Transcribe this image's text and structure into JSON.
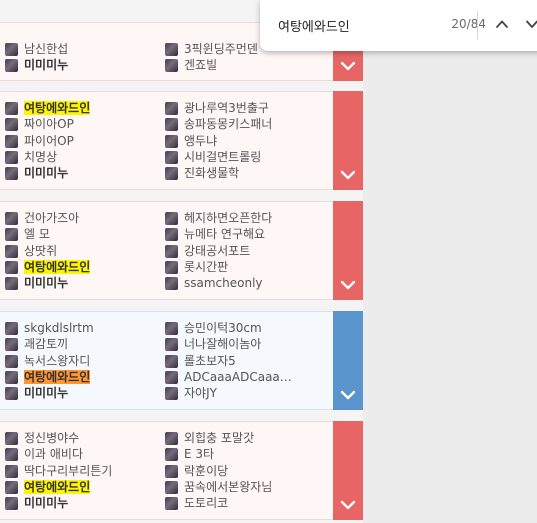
{
  "find_bar": {
    "query": "여탕에와드인",
    "match_count": "20/84",
    "prev_icon": "chevron-up-icon",
    "next_icon": "chevron-down-icon"
  },
  "colors": {
    "loss": "#e86565",
    "win": "#5a94cc",
    "highlight_match": "#fff500",
    "highlight_current": "#ff9632"
  },
  "matches": [
    {
      "result": "loss",
      "toggle_icon": "chevron-down-icon",
      "left_team": [
        {
          "name": "남신한섭",
          "bold": false,
          "hl": null
        },
        {
          "name": "미미미누",
          "bold": true,
          "hl": null
        }
      ],
      "right_team": [
        {
          "name": "3픽윈딩주먼덴",
          "bold": false
        },
        {
          "name": "겐죠빌",
          "bold": false
        }
      ]
    },
    {
      "result": "loss",
      "toggle_icon": "chevron-down-icon",
      "left_team": [
        {
          "name": "여탕에와드인",
          "bold": true,
          "hl": "match"
        },
        {
          "name": "짜이아OP",
          "bold": false,
          "hl": null
        },
        {
          "name": "파이어OP",
          "bold": false,
          "hl": null
        },
        {
          "name": "치명상",
          "bold": false,
          "hl": null
        },
        {
          "name": "미미미누",
          "bold": true,
          "hl": null
        }
      ],
      "right_team": [
        {
          "name": "광나루역3번출구",
          "bold": false
        },
        {
          "name": "송파동몽키스패너",
          "bold": false
        },
        {
          "name": "앵두냐",
          "bold": false
        },
        {
          "name": "시비걸면트롤링",
          "bold": false
        },
        {
          "name": "진화생물학",
          "bold": false
        }
      ]
    },
    {
      "result": "loss",
      "toggle_icon": "chevron-down-icon",
      "left_team": [
        {
          "name": "건아가즈아",
          "bold": false,
          "hl": null
        },
        {
          "name": "엘 모",
          "bold": false,
          "hl": null
        },
        {
          "name": "상땃쥐",
          "bold": false,
          "hl": null
        },
        {
          "name": "여탕에와드인",
          "bold": true,
          "hl": "match"
        },
        {
          "name": "미미미누",
          "bold": true,
          "hl": null
        }
      ],
      "right_team": [
        {
          "name": "헤지하면오픈한다",
          "bold": false
        },
        {
          "name": "뉴메타 연구해요",
          "bold": false
        },
        {
          "name": "강태공서포트",
          "bold": false
        },
        {
          "name": "롯시간판",
          "bold": false
        },
        {
          "name": "ssamcheonly",
          "bold": false
        }
      ]
    },
    {
      "result": "win",
      "toggle_icon": "chevron-down-icon",
      "left_team": [
        {
          "name": "skgkdlslrtm",
          "bold": false,
          "hl": null
        },
        {
          "name": "괘감토끼",
          "bold": false,
          "hl": null
        },
        {
          "name": "녹서스왕자디",
          "bold": false,
          "hl": null
        },
        {
          "name": "여탕에와드인",
          "bold": true,
          "hl": "current"
        },
        {
          "name": "미미미누",
          "bold": true,
          "hl": null
        }
      ],
      "right_team": [
        {
          "name": "승민이턱30cm",
          "bold": false
        },
        {
          "name": "너나잘해이놈아",
          "bold": false
        },
        {
          "name": "롤초보자5",
          "bold": false
        },
        {
          "name": "ADCaaaADCaaa…",
          "bold": false
        },
        {
          "name": "자야JY",
          "bold": false
        }
      ]
    },
    {
      "result": "loss",
      "toggle_icon": "chevron-down-icon",
      "left_team": [
        {
          "name": "정신병야수",
          "bold": false,
          "hl": null
        },
        {
          "name": "이과 애비다",
          "bold": false,
          "hl": null
        },
        {
          "name": "딱다구리부리튼기",
          "bold": false,
          "hl": null
        },
        {
          "name": "여탕에와드인",
          "bold": true,
          "hl": "match"
        },
        {
          "name": "미미미누",
          "bold": true,
          "hl": null
        }
      ],
      "right_team": [
        {
          "name": "외힙충 포말갓",
          "bold": false
        },
        {
          "name": "E 3타",
          "bold": false
        },
        {
          "name": "락훈이당",
          "bold": false
        },
        {
          "name": "꿈속에서본왕자님",
          "bold": false
        },
        {
          "name": "도토리코",
          "bold": false
        }
      ]
    }
  ]
}
